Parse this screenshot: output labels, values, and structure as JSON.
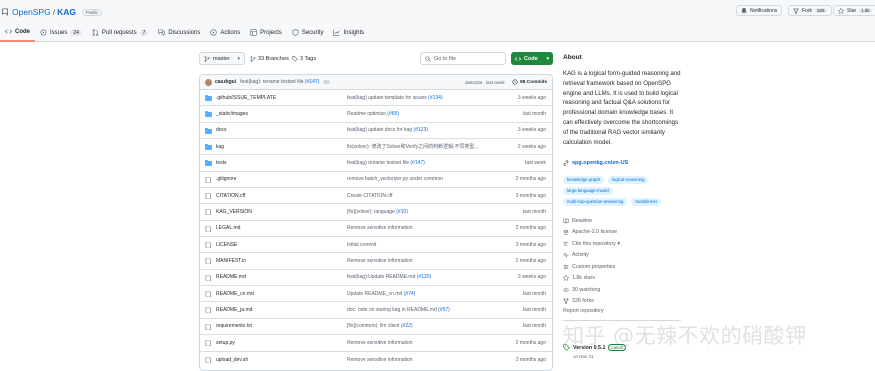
{
  "repo": {
    "owner": "OpenSPG",
    "slash": "/",
    "name": "KAG",
    "visibility": "Public"
  },
  "header_buttons": {
    "notifications": "Notifications",
    "fork_label": "Fork",
    "fork_count": "326",
    "star_label": "Star",
    "star_count": "1.8k"
  },
  "tabs": [
    {
      "label": "Code"
    },
    {
      "label": "Issues",
      "count": "24"
    },
    {
      "label": "Pull requests",
      "count": "7"
    },
    {
      "label": "Discussions"
    },
    {
      "label": "Actions"
    },
    {
      "label": "Projects"
    },
    {
      "label": "Security"
    },
    {
      "label": "Insights"
    }
  ],
  "toolbar": {
    "branch": "master",
    "branches": "33 Branches",
    "tags": "3 Tags",
    "goto_placeholder": "Go to file",
    "code_label": "Code"
  },
  "latest_commit": {
    "author": "caszkgui",
    "message": "feat(kag): rename testset file",
    "pr": "(#147)",
    "hash": "da6232e",
    "time": "last week",
    "commits": "98 Commits"
  },
  "files": [
    {
      "name": ".github/ISSUE_TEMPLATE",
      "type": "dir",
      "msg": "feat(kag) update template for issues",
      "pr": "(#134)",
      "time": "3 weeks ago"
    },
    {
      "name": "_static/images",
      "type": "dir",
      "msg": "Readme optimize",
      "pr": "(#65)",
      "time": "last month"
    },
    {
      "name": "docs",
      "type": "dir",
      "msg": "feat(kag) update docs for kag",
      "pr": "(#123)",
      "time": "3 weeks ago"
    },
    {
      "name": "kag",
      "type": "dir",
      "msg": "fix(solver): 修改了Solver和Verify之间的判断逻辑,不同类型...",
      "pr": "",
      "time": "2 weeks ago"
    },
    {
      "name": "tests",
      "type": "dir",
      "msg": "feat(kag) rename testset file",
      "pr": "(#147)",
      "time": "last week"
    },
    {
      "name": ".gitignore",
      "type": "file",
      "msg": "remove batch_vectorizer.py under common",
      "pr": "",
      "time": "2 months ago"
    },
    {
      "name": "CITATION.cff",
      "type": "file",
      "msg": "Create CITATION.cff",
      "pr": "",
      "time": "3 months ago"
    },
    {
      "name": "KAG_VERSION",
      "type": "file",
      "msg": "[fix](solver): language",
      "pr": "(#10)",
      "time": "last month"
    },
    {
      "name": "LEGAL.md",
      "type": "file",
      "msg": "Remove sensitive information",
      "pr": "",
      "time": "2 months ago"
    },
    {
      "name": "LICENSE",
      "type": "file",
      "msg": "Initial commit",
      "pr": "",
      "time": "3 months ago"
    },
    {
      "name": "MANIFEST.in",
      "type": "file",
      "msg": "Remove sensitive information",
      "pr": "",
      "time": "2 months ago"
    },
    {
      "name": "README.md",
      "type": "file",
      "msg": "feat(kag):Update README.md",
      "pr": "(#120)",
      "time": "3 weeks ago"
    },
    {
      "name": "README_cn.md",
      "type": "file",
      "msg": "Update README_cn.md",
      "pr": "(#74)",
      "time": "last month"
    },
    {
      "name": "README_ja.md",
      "type": "file",
      "msg": "doc: note on staring kag in README.md",
      "pr": "(#57)",
      "time": "last month"
    },
    {
      "name": "requirements.txt",
      "type": "file",
      "msg": "[fix](common): llm client",
      "pr": "(#22)",
      "time": "last month"
    },
    {
      "name": "setup.py",
      "type": "file",
      "msg": "Remove sensitive information",
      "pr": "",
      "time": "2 months ago"
    },
    {
      "name": "upload_dev.sh",
      "type": "file",
      "msg": "Remove sensitive information",
      "pr": "",
      "time": "2 months ago"
    }
  ],
  "about": {
    "title": "About",
    "description": "KAG is a logical form-guided reasoning and retrieval framework based on OpenSPG engine and LLMs. It is used to build logical reasoning and factual Q&A solutions for professional domain knowledge bases. It can effectively overcome the shortcomings of the traditional RAG vector similarity calculation model.",
    "link": "spg.openkg.cn/en-US",
    "topics": [
      "knowledge-graph",
      "logical-reasoning",
      "large-language-model",
      "multi-hop-question-answering",
      "trustfulness"
    ],
    "meta": [
      {
        "icon": "book-icon",
        "label": "Readme"
      },
      {
        "icon": "scale-icon",
        "label": "Apache-2.0 license"
      },
      {
        "icon": "quote-icon",
        "label": "Cite this repository ▾"
      },
      {
        "icon": "pulse-icon",
        "label": "Activity"
      },
      {
        "icon": "sliders-icon",
        "label": "Custom properties"
      },
      {
        "icon": "star-icon",
        "label": "1.8k stars"
      },
      {
        "icon": "eye-icon",
        "label": "30 watching"
      },
      {
        "icon": "fork-icon",
        "label": "326 forks"
      }
    ],
    "report": "Report repository",
    "release_version": "Version 0.5.1",
    "release_latest": "Latest",
    "release_date": "on Nov 21"
  },
  "watermark": "知乎 @无辣不欢的硝酸钾",
  "colors": {
    "accent": "#0969da",
    "green": "#1f883d",
    "tab_underline": "#fd8c73",
    "folder": "#54aeff"
  }
}
